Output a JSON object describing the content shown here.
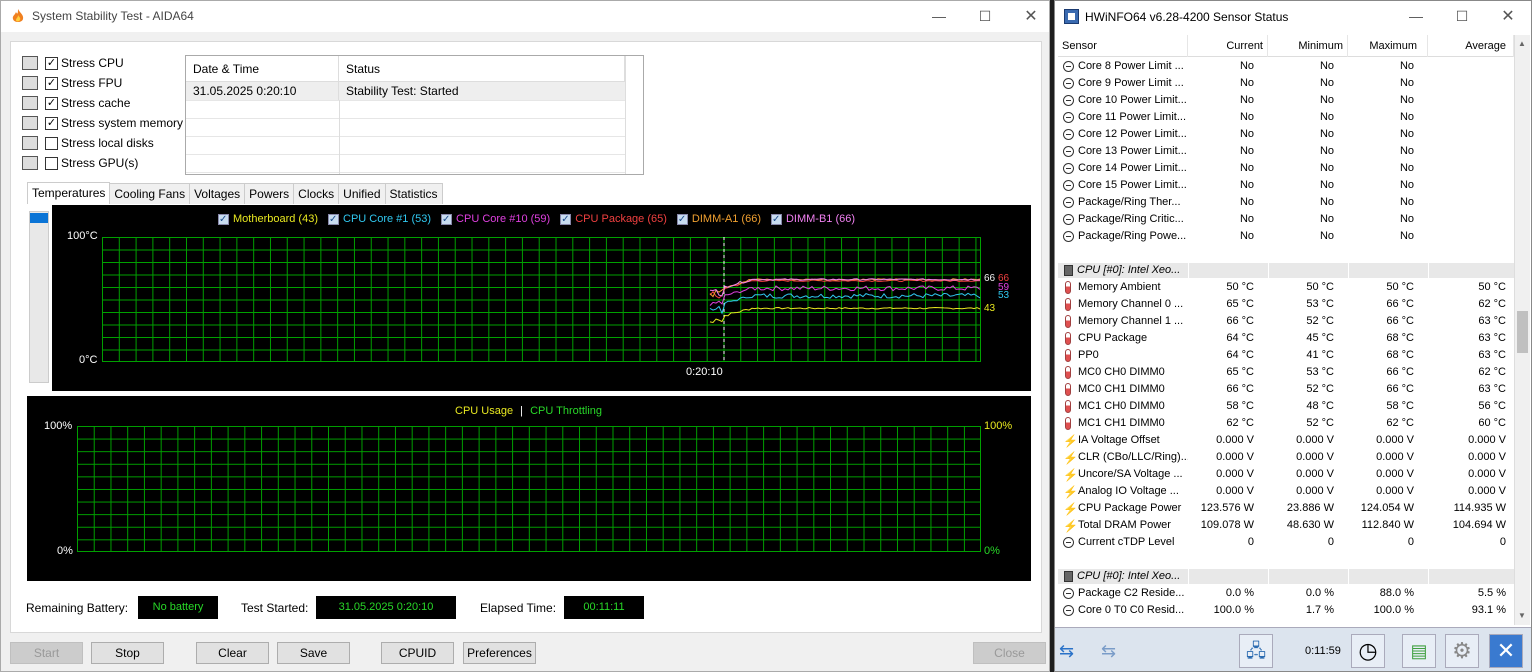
{
  "aida": {
    "title": "System Stability Test - AIDA64",
    "stress_options": [
      {
        "label": "Stress CPU",
        "checked": true,
        "icon": "cpu-chip-icon"
      },
      {
        "label": "Stress FPU",
        "checked": true,
        "icon": "fpu-chip-icon"
      },
      {
        "label": "Stress cache",
        "checked": true,
        "icon": "cache-chip-icon"
      },
      {
        "label": "Stress system memory",
        "checked": true,
        "icon": "memory-module-icon"
      },
      {
        "label": "Stress local disks",
        "checked": false,
        "icon": "disk-drive-icon"
      },
      {
        "label": "Stress GPU(s)",
        "checked": false,
        "icon": "gpu-monitor-icon"
      }
    ],
    "status_table": {
      "headers": [
        "Date & Time",
        "Status"
      ],
      "rows": [
        [
          "31.05.2025 0:20:10",
          "Stability Test: Started"
        ]
      ]
    },
    "tabs": [
      "Temperatures",
      "Cooling Fans",
      "Voltages",
      "Powers",
      "Clocks",
      "Unified",
      "Statistics"
    ],
    "active_tab": "Temperatures",
    "temp_graph": {
      "legend": [
        {
          "label": "Motherboard (43)",
          "color": "#e8e820"
        },
        {
          "label": "CPU Core #1 (53)",
          "color": "#30c8f0"
        },
        {
          "label": "CPU Core #10 (59)",
          "color": "#e040e0"
        },
        {
          "label": "CPU Package (65)",
          "color": "#f04040"
        },
        {
          "label": "DIMM-A1 (66)",
          "color": "#f0a030"
        },
        {
          "label": "DIMM-B1 (66)",
          "color": "#f080f0"
        }
      ],
      "y_top": "100°C",
      "y_bottom": "0°C",
      "x_marker": "0:20:10",
      "end_values": [
        {
          "text": "66",
          "color": "#f0f0f0"
        },
        {
          "text": "66",
          "color": "#f04040"
        },
        {
          "text": "59",
          "color": "#e040e0"
        },
        {
          "text": "53",
          "color": "#30c8f0"
        },
        {
          "text": "43",
          "color": "#e8e820"
        }
      ]
    },
    "usage_graph": {
      "legend_usage": "CPU Usage",
      "legend_sep": "|",
      "legend_throttle": "CPU Throttling",
      "left_top": "100%",
      "left_bottom": "0%",
      "right_top": "100%",
      "right_bottom": "0%"
    },
    "remaining_battery_label": "Remaining Battery:",
    "remaining_battery_value": "No battery",
    "test_started_label": "Test Started:",
    "test_started_value": "31.05.2025 0:20:10",
    "elapsed_label": "Elapsed Time:",
    "elapsed_value": "00:11:11",
    "buttons": {
      "start": "Start",
      "stop": "Stop",
      "clear": "Clear",
      "save": "Save",
      "cpuid": "CPUID",
      "preferences": "Preferences",
      "close": "Close"
    }
  },
  "hwinfo": {
    "title": "HWiNFO64 v6.28-4200 Sensor Status",
    "columns": [
      "Sensor",
      "Current",
      "Minimum",
      "Maximum",
      "Average"
    ],
    "rows": [
      {
        "type": "row",
        "icon": "circle",
        "name": "Core 8 Power Limit ...",
        "cur": "No",
        "min": "No",
        "max": "No",
        "avg": ""
      },
      {
        "type": "row",
        "icon": "circle",
        "name": "Core 9 Power Limit ...",
        "cur": "No",
        "min": "No",
        "max": "No",
        "avg": ""
      },
      {
        "type": "row",
        "icon": "circle",
        "name": "Core 10 Power Limit...",
        "cur": "No",
        "min": "No",
        "max": "No",
        "avg": ""
      },
      {
        "type": "row",
        "icon": "circle",
        "name": "Core 11 Power Limit...",
        "cur": "No",
        "min": "No",
        "max": "No",
        "avg": ""
      },
      {
        "type": "row",
        "icon": "circle",
        "name": "Core 12 Power Limit...",
        "cur": "No",
        "min": "No",
        "max": "No",
        "avg": ""
      },
      {
        "type": "row",
        "icon": "circle",
        "name": "Core 13 Power Limit...",
        "cur": "No",
        "min": "No",
        "max": "No",
        "avg": ""
      },
      {
        "type": "row",
        "icon": "circle",
        "name": "Core 14 Power Limit...",
        "cur": "No",
        "min": "No",
        "max": "No",
        "avg": ""
      },
      {
        "type": "row",
        "icon": "circle",
        "name": "Core 15 Power Limit...",
        "cur": "No",
        "min": "No",
        "max": "No",
        "avg": ""
      },
      {
        "type": "row",
        "icon": "circle",
        "name": "Package/Ring Ther...",
        "cur": "No",
        "min": "No",
        "max": "No",
        "avg": ""
      },
      {
        "type": "row",
        "icon": "circle",
        "name": "Package/Ring Critic...",
        "cur": "No",
        "min": "No",
        "max": "No",
        "avg": ""
      },
      {
        "type": "row",
        "icon": "circle",
        "name": "Package/Ring Powe...",
        "cur": "No",
        "min": "No",
        "max": "No",
        "avg": ""
      },
      {
        "type": "spacer"
      },
      {
        "type": "group",
        "name": "CPU [#0]: Intel Xeo..."
      },
      {
        "type": "row",
        "icon": "therm",
        "name": "Memory Ambient",
        "cur": "50 °C",
        "min": "50 °C",
        "max": "50 °C",
        "avg": "50 °C"
      },
      {
        "type": "row",
        "icon": "therm",
        "name": "Memory Channel 0 ...",
        "cur": "65 °C",
        "min": "53 °C",
        "max": "66 °C",
        "avg": "62 °C"
      },
      {
        "type": "row",
        "icon": "therm",
        "name": "Memory Channel 1 ...",
        "cur": "66 °C",
        "min": "52 °C",
        "max": "66 °C",
        "avg": "63 °C"
      },
      {
        "type": "row",
        "icon": "therm",
        "name": "CPU Package",
        "cur": "64 °C",
        "min": "45 °C",
        "max": "68 °C",
        "avg": "63 °C"
      },
      {
        "type": "row",
        "icon": "therm",
        "name": "PP0",
        "cur": "64 °C",
        "min": "41 °C",
        "max": "68 °C",
        "avg": "63 °C"
      },
      {
        "type": "row",
        "icon": "therm",
        "name": "MC0 CH0 DIMM0",
        "cur": "65 °C",
        "min": "53 °C",
        "max": "66 °C",
        "avg": "62 °C"
      },
      {
        "type": "row",
        "icon": "therm",
        "name": "MC0 CH1 DIMM0",
        "cur": "66 °C",
        "min": "52 °C",
        "max": "66 °C",
        "avg": "63 °C"
      },
      {
        "type": "row",
        "icon": "therm",
        "name": "MC1 CH0 DIMM0",
        "cur": "58 °C",
        "min": "48 °C",
        "max": "58 °C",
        "avg": "56 °C"
      },
      {
        "type": "row",
        "icon": "therm",
        "name": "MC1 CH1 DIMM0",
        "cur": "62 °C",
        "min": "52 °C",
        "max": "62 °C",
        "avg": "60 °C"
      },
      {
        "type": "row",
        "icon": "bolt",
        "name": "IA Voltage Offset",
        "cur": "0.000 V",
        "min": "0.000 V",
        "max": "0.000 V",
        "avg": "0.000 V"
      },
      {
        "type": "row",
        "icon": "bolt",
        "name": "CLR (CBo/LLC/Ring)...",
        "cur": "0.000 V",
        "min": "0.000 V",
        "max": "0.000 V",
        "avg": "0.000 V"
      },
      {
        "type": "row",
        "icon": "bolt",
        "name": "Uncore/SA Voltage ...",
        "cur": "0.000 V",
        "min": "0.000 V",
        "max": "0.000 V",
        "avg": "0.000 V"
      },
      {
        "type": "row",
        "icon": "bolt",
        "name": "Analog IO Voltage ...",
        "cur": "0.000 V",
        "min": "0.000 V",
        "max": "0.000 V",
        "avg": "0.000 V"
      },
      {
        "type": "row",
        "icon": "bolt",
        "name": "CPU Package Power",
        "cur": "123.576 W",
        "min": "23.886 W",
        "max": "124.054 W",
        "avg": "114.935 W"
      },
      {
        "type": "row",
        "icon": "bolt",
        "name": "Total DRAM Power",
        "cur": "109.078 W",
        "min": "48.630 W",
        "max": "112.840 W",
        "avg": "104.694 W"
      },
      {
        "type": "row",
        "icon": "circle",
        "name": "Current cTDP Level",
        "cur": "0",
        "min": "0",
        "max": "0",
        "avg": "0"
      },
      {
        "type": "spacer"
      },
      {
        "type": "group",
        "name": "CPU [#0]: Intel Xeo..."
      },
      {
        "type": "row",
        "icon": "circle",
        "name": "Package C2 Reside...",
        "cur": "0.0 %",
        "min": "0.0 %",
        "max": "88.0 %",
        "avg": "5.5 %"
      },
      {
        "type": "row",
        "icon": "circle",
        "name": "Core 0 T0 C0 Resid...",
        "cur": "100.0 %",
        "min": "1.7 %",
        "max": "100.0 %",
        "avg": "93.1 %"
      }
    ],
    "elapsed": "0:11:59"
  }
}
